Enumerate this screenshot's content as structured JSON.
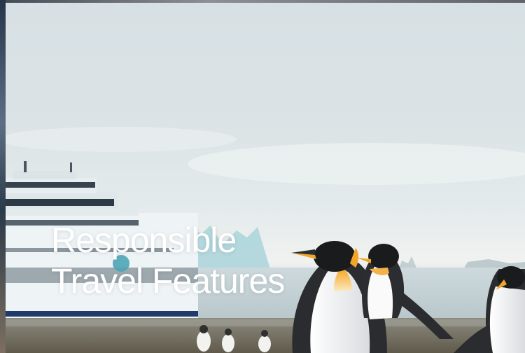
{
  "hero": {
    "headline_line1": "Responsible",
    "headline_line2": "Travel Features",
    "image_subject": "expedition-ship-with-king-penguins"
  },
  "colors": {
    "sky": "#dbe3e6",
    "headline_text": "#ffffff",
    "ship_hull": "#eef3f5",
    "penguin_orange": "#f2a629"
  }
}
